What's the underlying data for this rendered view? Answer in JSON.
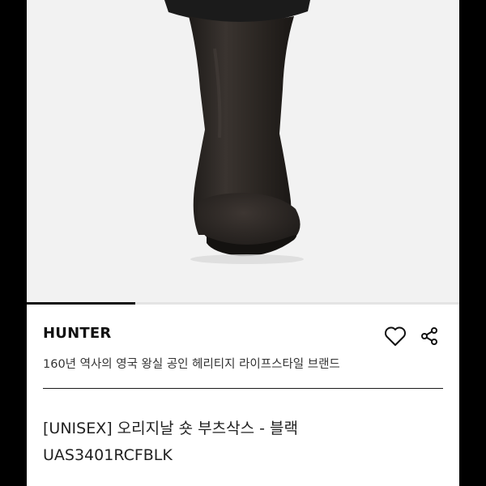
{
  "image_carousel": {
    "progress_fraction": 0.25,
    "image": "black-rain-boot-front-view"
  },
  "brand": {
    "name": "HUNTER",
    "description": "160년 역사의 영국 왕실 공인 헤리티지 라이프스타일 브랜드"
  },
  "actions": {
    "wishlist_icon": "heart-outline-icon",
    "share_icon": "share-icon"
  },
  "product": {
    "title": "[UNISEX] 오리지날 숏 부츠삭스 - 블랙",
    "code": "UAS3401RCFBLK"
  },
  "colors": {
    "frame_background": "#000000",
    "page_background": "#ffffff",
    "image_background": "#f2f2f2",
    "boot": "#2b2622",
    "text": "#222222"
  }
}
